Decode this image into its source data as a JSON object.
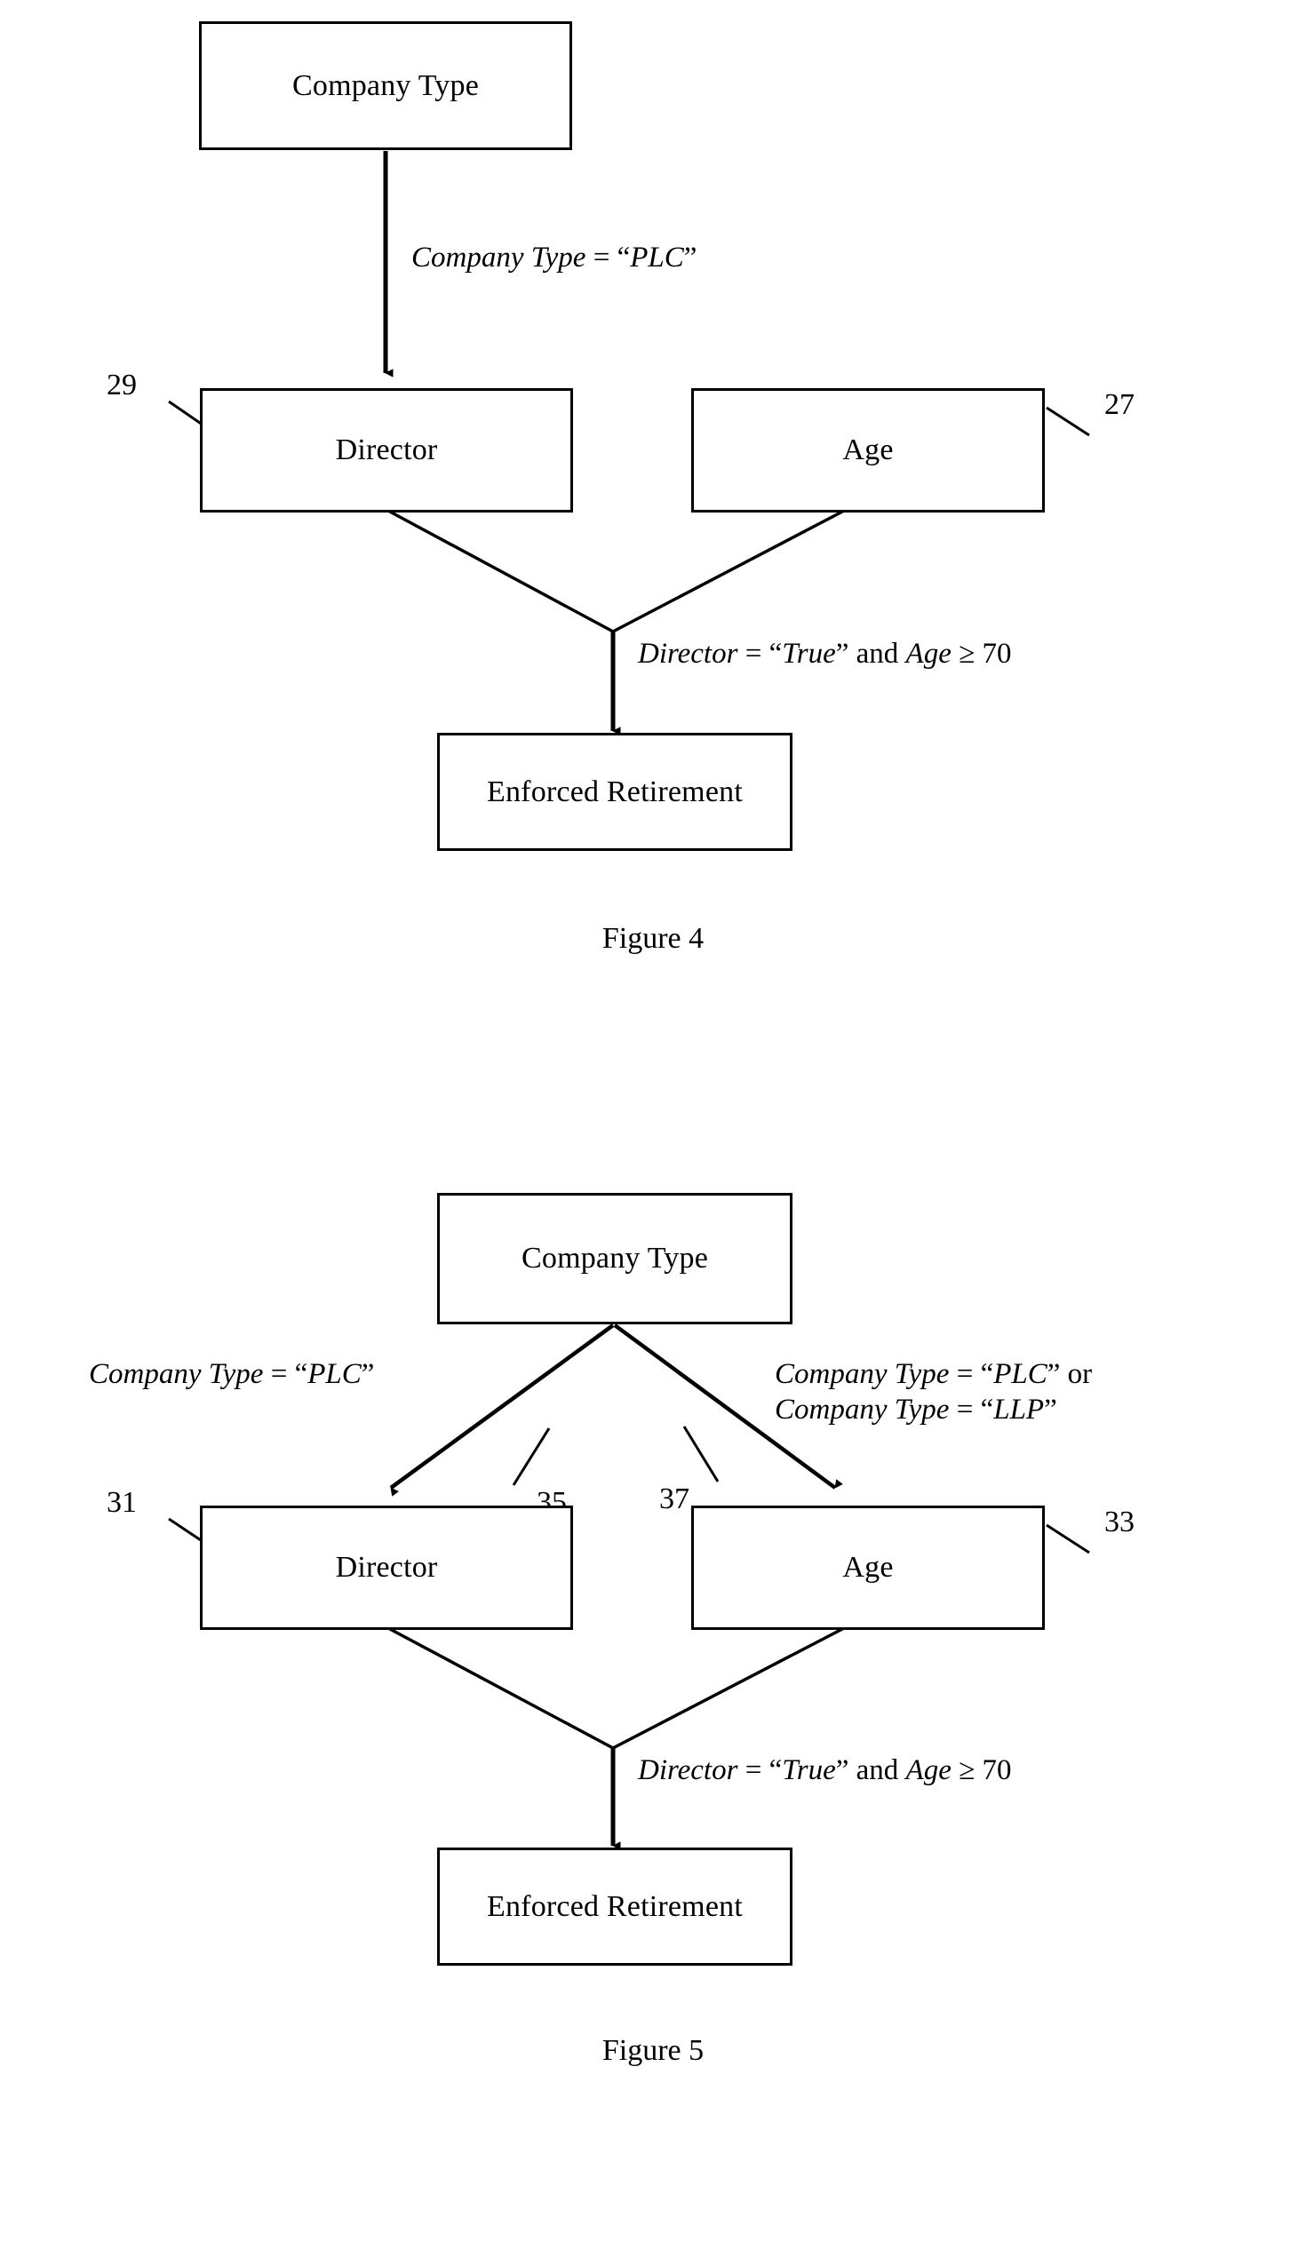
{
  "document": {
    "type": "patent-drawing-sheet",
    "background_color": "#ffffff",
    "ink_color": "#000000"
  },
  "figures": [
    {
      "id": "figure-4",
      "caption": "Figure 4",
      "nodes": [
        {
          "id": "fig4-company-type",
          "label": "Company Type"
        },
        {
          "id": "fig4-director",
          "label": "Director",
          "ref": "29"
        },
        {
          "id": "fig4-age",
          "label": "Age",
          "ref": "27"
        },
        {
          "id": "fig4-enforced-retirement",
          "label": "Enforced Retirement"
        }
      ],
      "edge_labels": [
        {
          "id": "fig4-edge-company-type",
          "lines": [
            [
              {
                "text": "Company Type",
                "style": "italic"
              },
              {
                "text": " = ",
                "style": "roman"
              },
              {
                "text": "“",
                "style": "roman"
              },
              {
                "text": "PLC",
                "style": "italic"
              },
              {
                "text": "”",
                "style": "roman"
              }
            ]
          ]
        },
        {
          "id": "fig4-edge-condition",
          "lines": [
            [
              {
                "text": "Director",
                "style": "italic"
              },
              {
                "text": " = ",
                "style": "roman"
              },
              {
                "text": "“",
                "style": "roman"
              },
              {
                "text": "True",
                "style": "italic"
              },
              {
                "text": "” and ",
                "style": "roman"
              },
              {
                "text": "Age",
                "style": "italic"
              },
              {
                "text": " ≥ 70",
                "style": "roman"
              }
            ]
          ]
        }
      ]
    },
    {
      "id": "figure-5",
      "caption": "Figure 5",
      "nodes": [
        {
          "id": "fig5-company-type",
          "label": "Company Type"
        },
        {
          "id": "fig5-director",
          "label": "Director",
          "ref": "31"
        },
        {
          "id": "fig5-age",
          "label": "Age",
          "ref": "33"
        },
        {
          "id": "fig5-enforced-retirement",
          "label": "Enforced Retirement"
        }
      ],
      "branch_refs": [
        {
          "id": "fig5-branch-left-ref",
          "ref": "35"
        },
        {
          "id": "fig5-branch-right-ref",
          "ref": "37"
        }
      ],
      "edge_labels": [
        {
          "id": "fig5-edge-left",
          "lines": [
            [
              {
                "text": "Company Type",
                "style": "italic"
              },
              {
                "text": " = ",
                "style": "roman"
              },
              {
                "text": "“",
                "style": "roman"
              },
              {
                "text": "PLC",
                "style": "italic"
              },
              {
                "text": "”",
                "style": "roman"
              }
            ]
          ]
        },
        {
          "id": "fig5-edge-right",
          "lines": [
            [
              {
                "text": "Company Type",
                "style": "italic"
              },
              {
                "text": " = ",
                "style": "roman"
              },
              {
                "text": "“",
                "style": "roman"
              },
              {
                "text": "PLC",
                "style": "italic"
              },
              {
                "text": "” or",
                "style": "roman"
              }
            ],
            [
              {
                "text": "Company Type",
                "style": "italic"
              },
              {
                "text": " = ",
                "style": "roman"
              },
              {
                "text": "“",
                "style": "roman"
              },
              {
                "text": "LLP",
                "style": "italic"
              },
              {
                "text": "”",
                "style": "roman"
              }
            ]
          ]
        },
        {
          "id": "fig5-edge-condition",
          "lines": [
            [
              {
                "text": "Director",
                "style": "italic"
              },
              {
                "text": " = ",
                "style": "roman"
              },
              {
                "text": "“",
                "style": "roman"
              },
              {
                "text": "True",
                "style": "italic"
              },
              {
                "text": "” and ",
                "style": "roman"
              },
              {
                "text": "Age",
                "style": "italic"
              },
              {
                "text": " ≥ 70",
                "style": "roman"
              }
            ]
          ]
        }
      ]
    }
  ]
}
